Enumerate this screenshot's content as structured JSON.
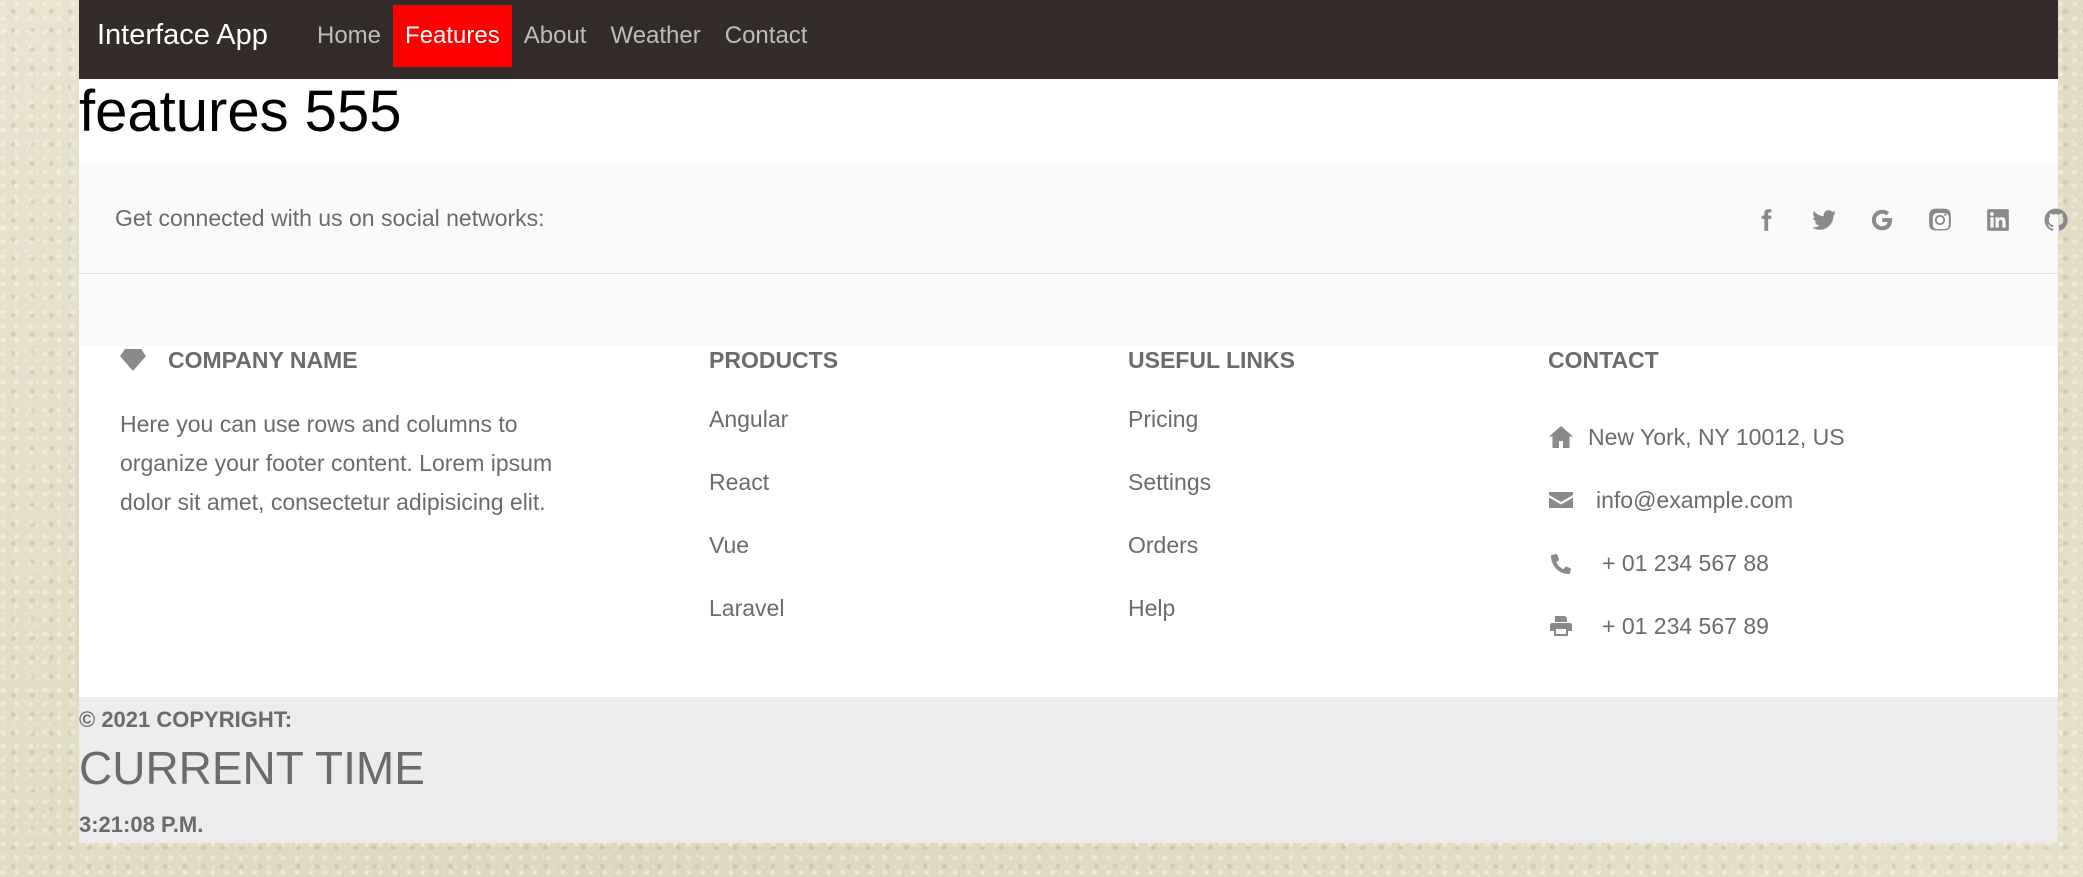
{
  "navbar": {
    "brand": "Interface App",
    "links": [
      {
        "label": "Home",
        "active": false
      },
      {
        "label": "Features",
        "active": true
      },
      {
        "label": "About",
        "active": false
      },
      {
        "label": "Weather",
        "active": false
      },
      {
        "label": "Contact",
        "active": false
      }
    ]
  },
  "main": {
    "title": "features 555"
  },
  "social": {
    "text": "Get connected with us on social networks:",
    "icons": [
      "facebook-icon",
      "twitter-icon",
      "google-icon",
      "instagram-icon",
      "linkedin-icon",
      "github-icon"
    ]
  },
  "footer": {
    "company": {
      "icon": "gem-icon",
      "heading": "Company name",
      "description": "Here you can use rows and columns to organize your footer content. Lorem ipsum dolor sit amet, consectetur adipisicing elit."
    },
    "products": {
      "heading": "Products",
      "links": [
        "Angular",
        "React",
        "Vue",
        "Laravel"
      ]
    },
    "useful": {
      "heading": "Useful links",
      "links": [
        "Pricing",
        "Settings",
        "Orders",
        "Help"
      ]
    },
    "contact": {
      "heading": "Contact",
      "items": [
        {
          "icon": "home-icon",
          "text": "New York, NY 10012, US"
        },
        {
          "icon": "envelope-icon",
          "text": "info@example.com"
        },
        {
          "icon": "phone-icon",
          "text": "+ 01 234 567 88"
        },
        {
          "icon": "print-icon",
          "text": "+ 01 234 567 89"
        }
      ]
    }
  },
  "bottom": {
    "copyright": "© 2021 COPYRIGHT:",
    "current_time_label": "CURRENT TIME",
    "time": "3:21:08 P.M."
  },
  "colors": {
    "navbar_bg": "#332c2b",
    "active_link_bg": "#ff0000",
    "text_gray": "#6b6b6b",
    "icon_gray": "#8a8a8a"
  }
}
